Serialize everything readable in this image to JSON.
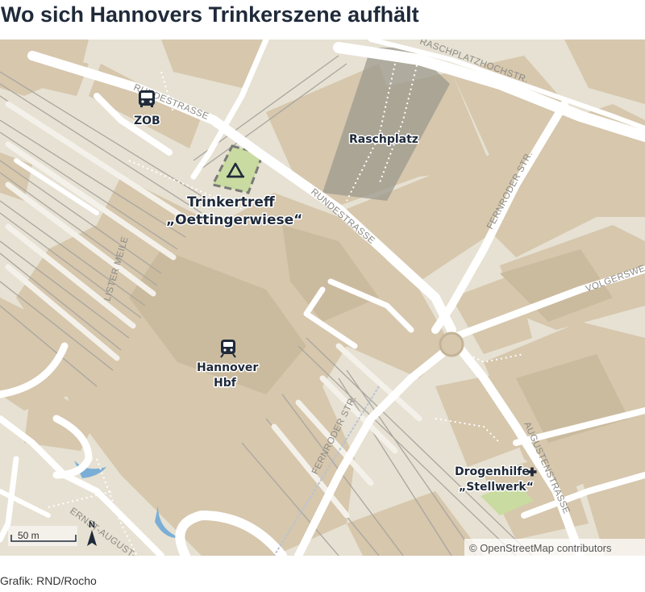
{
  "title": "Wo sich Hannovers Trinkerszene aufhält",
  "credit": "Grafik: RND/Rocho",
  "attribution": "© OpenStreetMap contributors",
  "scale_label": "50 m",
  "north_label": "N",
  "streets": {
    "rundestrasse_top": "RUNDESTRASSE",
    "raschplatzhochstr": "RASCHPLATZHOCHSTR.",
    "rundestrasse_mid": "RUNDESTRASSE",
    "fernroder_upper": "FERNRODER STR.",
    "volgersweg": "VOLGERSWEG",
    "lister_meile": "LISTER MEILE",
    "fernroder_lower": "FERNRODER STR.",
    "augustenstrasse": "AUGUSTENSTRASSE",
    "ernst_august": "ERNST-AUGUST-"
  },
  "places": {
    "zob": "ZOB",
    "raschplatz": "Raschplatz",
    "trinkertreff_line1": "Trinkertreff",
    "trinkertreff_line2": "„Oettingerwiese“",
    "hbf_line1": "Hannover",
    "hbf_line2": "Hbf",
    "drogenhilfe_line1": "Drogenhilfe",
    "drogenhilfe_line2": "„Stellwerk“"
  },
  "icons": [
    "bus-icon",
    "train-icon",
    "tent-icon",
    "cross-icon",
    "north-arrow-icon"
  ],
  "colors": {
    "background": "#e6e1d2",
    "building": "#d6c7ad",
    "building_dark": "#c9b99c",
    "road": "#ffffff",
    "rail": "#a9a6a0",
    "park": "#c9dba0",
    "water": "#7aaed6",
    "raschplatz_overlay": "#9c9a8e",
    "label": "#1f2a3a"
  }
}
